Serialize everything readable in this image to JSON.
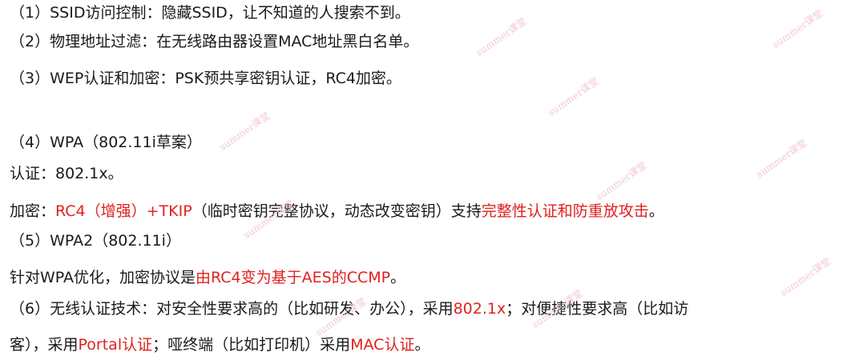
{
  "lines": [
    {
      "segments": [
        {
          "text": "（1）SSID访问控制：隐藏SSID，让不知道的人搜索不到。"
        }
      ]
    },
    {
      "segments": [
        {
          "text": "（2）物理地址过滤：在无线路由器设置MAC地址黑白名单。"
        }
      ]
    },
    {
      "segments": [
        {
          "text": "（3）WEP认证和加密：PSK预共享密钥认证，RC4加密。"
        }
      ]
    },
    {
      "segments": [
        {
          "text": "（4）WPA（802.11i草案）"
        }
      ]
    },
    {
      "segments": [
        {
          "text": "认证：802.1x。"
        }
      ]
    },
    {
      "segments": [
        {
          "text": "加密："
        },
        {
          "text": "RC4（增强）+TKIP"
        },
        {
          "text": "（临时密钥完整协议，动态改变密钥）支持"
        },
        {
          "text": "完整性认证和防重放攻击"
        },
        {
          "text": "。"
        }
      ]
    },
    {
      "segments": [
        {
          "text": "（5）WPA2（802.11i）"
        }
      ]
    },
    {
      "segments": [
        {
          "text": "针对WPA优化，加密协议是"
        },
        {
          "text": "由RC4变为基于AES的CCMP"
        },
        {
          "text": "。"
        }
      ]
    },
    {
      "segments": [
        {
          "text": "（6）无线认证技术：对安全性要求高的（比如研发、办公），采用"
        },
        {
          "text": "802.1x"
        },
        {
          "text": "；对便捷性要求高（比如访"
        }
      ]
    },
    {
      "segments": [
        {
          "text": "客），采用"
        },
        {
          "text": "Portal认证"
        },
        {
          "text": "；哑终端（比如打印机）采用"
        },
        {
          "text": "MAC认证"
        },
        {
          "text": "。"
        }
      ]
    }
  ],
  "watermark": "summer课堂",
  "colors": {
    "text": "#1a1a1a",
    "highlight": "#e0211e"
  }
}
